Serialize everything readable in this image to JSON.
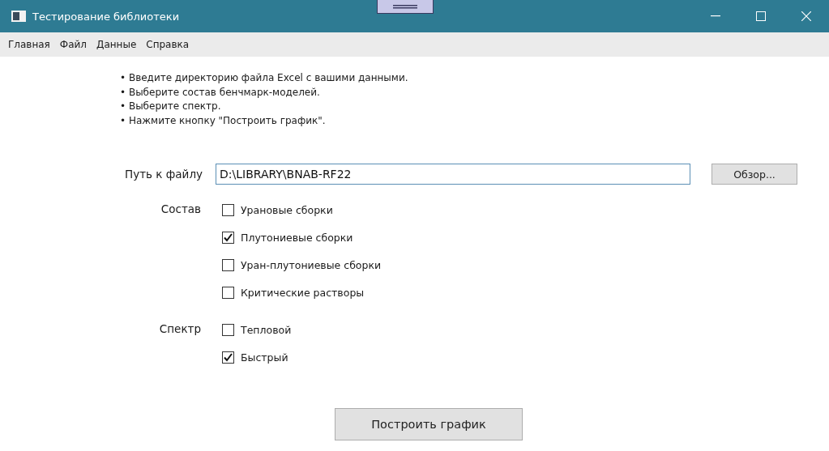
{
  "window": {
    "title": "Тестирование библиотеки"
  },
  "menu": [
    "Главная",
    "Файл",
    "Данные",
    "Справка"
  ],
  "instructions": [
    "• Введите директорию файла Excel с вашими данными.",
    "• Выберите состав бенчмарк-моделей.",
    "• Выберите спектр.",
    "• Нажмите кнопку \"Построить график\"."
  ],
  "file_path": {
    "label": "Путь к файлу",
    "value": "D:\\LIBRARY\\BNAB-RF22",
    "browse_button": "Обзор..."
  },
  "groups": [
    {
      "label": "Состав",
      "options": [
        {
          "label": "Урановые сборки",
          "checked": false
        },
        {
          "label": "Плутониевые сборки",
          "checked": true
        },
        {
          "label": "Уран-плутониевые сборки",
          "checked": false
        },
        {
          "label": "Критические растворы",
          "checked": false
        }
      ]
    },
    {
      "label": "Спектр",
      "options": [
        {
          "label": "Тепловой",
          "checked": false
        },
        {
          "label": "Быстрый",
          "checked": true
        }
      ]
    }
  ],
  "build_button": "Построить график"
}
